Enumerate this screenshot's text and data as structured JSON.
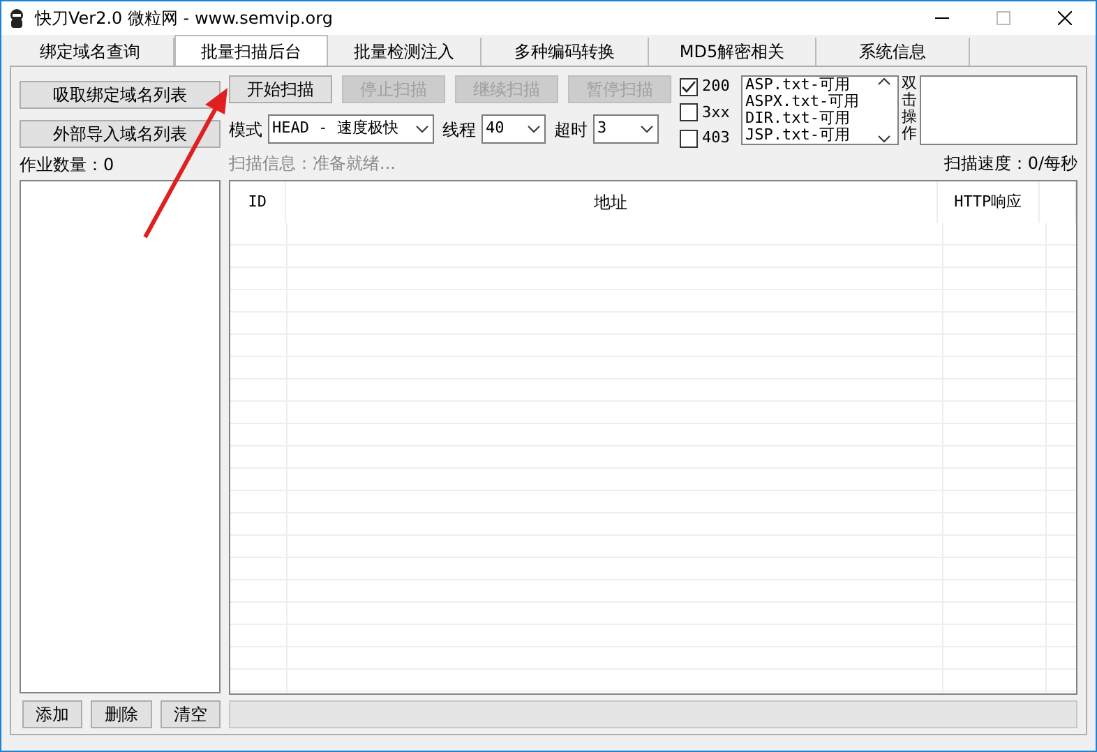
{
  "window": {
    "title": "快刀Ver2.0  微粒网 - www.semvip.org"
  },
  "tabs": [
    {
      "label": "绑定域名查询",
      "selected": false
    },
    {
      "label": "批量扫描后台",
      "selected": true
    },
    {
      "label": "批量检测注入",
      "selected": false
    },
    {
      "label": "多种编码转换",
      "selected": false
    },
    {
      "label": "MD5解密相关",
      "selected": false
    },
    {
      "label": "系统信息",
      "selected": false
    }
  ],
  "domain_buttons": [
    "吸取绑定域名列表",
    "外部导入域名列表"
  ],
  "job_count": "作业数量：0",
  "list_buttons": [
    "添加",
    "删除",
    "清空"
  ],
  "scan_buttons": [
    {
      "label": "开始扫描",
      "disabled": false
    },
    {
      "label": "停止扫描",
      "disabled": true
    },
    {
      "label": "继续扫描",
      "disabled": true
    },
    {
      "label": "暂停扫描",
      "disabled": true
    }
  ],
  "options": [
    {
      "label": "模式",
      "value": "HEAD - 速度极快"
    },
    {
      "label": "线程",
      "value": "40"
    },
    {
      "label": "超时",
      "value": "3"
    }
  ],
  "status_filters": [
    {
      "label": "200",
      "checked": true
    },
    {
      "label": "3xx",
      "checked": false
    },
    {
      "label": "403",
      "checked": false
    }
  ],
  "dictionaries": [
    "ASP.txt-可用",
    "ASPX.txt-可用",
    "DIR.txt-可用",
    "JSP.txt-可用"
  ],
  "side_label": "双击操作",
  "scan_info": "扫描信息：准备就绪...",
  "scan_speed": "扫描速度：0/每秒",
  "table": {
    "columns": [
      "ID",
      "地址",
      "HTTP响应"
    ]
  }
}
